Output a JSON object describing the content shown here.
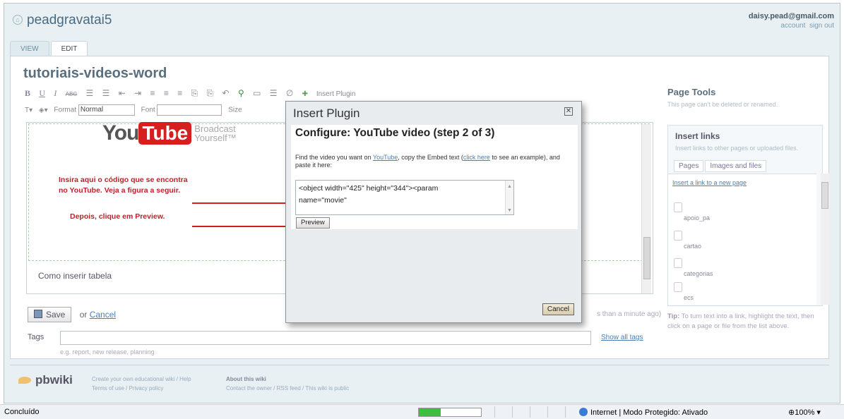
{
  "wiki": {
    "name": "peadgravatai5"
  },
  "user": {
    "email": "daisy.pead@gmail.com",
    "account": "account",
    "signout": "sign out"
  },
  "tabs": [
    {
      "label": "VIEW"
    },
    {
      "label": "EDIT",
      "active": true
    }
  ],
  "page": {
    "title": "tutoriais-videos-word"
  },
  "toolbar": {
    "row1": [
      "B",
      "U",
      "I",
      "ABC",
      "☰",
      "☰",
      "⇤",
      "⇥",
      "≡",
      "≡",
      "≡",
      "⎘",
      "⎘",
      "↶",
      "⚲",
      "▭",
      "☰",
      "∅"
    ],
    "insert_plugin": "Insert Plugin",
    "format_label": "Format",
    "format_value": "Normal",
    "font_label": "Font",
    "font_value": "",
    "size_label": "Size"
  },
  "editor": {
    "yt_you": "You",
    "yt_tube": "Tube",
    "yt_tag1": "Broadcast",
    "yt_tag2": "Yourself™",
    "note1": "Insira aqui o código que se encontra no YouTube. Veja a figura a seguir.",
    "note2": "Depois, clique em Preview.",
    "section2": "Como inserir tabela"
  },
  "actions": {
    "save": "Save",
    "or": "or",
    "cancel": "Cancel",
    "saved_msg": "s than a minute ago)"
  },
  "tags": {
    "label": "Tags",
    "hint": "e.g. report, new release, planning",
    "show_all": "Show all tags"
  },
  "sidebar": {
    "page_tools": "Page Tools",
    "page_tools_note": "This page can't be deleted or renamed.",
    "insert_links": "Insert links",
    "insert_links_note": "Insert links to other pages or uploaded files.",
    "tab_pages": "Pages",
    "tab_files": "Images and files",
    "new_page_link": "Insert a link to a new page",
    "items": [
      {
        "name": "apoio_pa"
      },
      {
        "name": "cartao"
      },
      {
        "name": "categorias"
      },
      {
        "name": "ecs"
      }
    ],
    "tip_label": "Tip:",
    "tip_text": "To turn text into a link, highlight the text, then click on a page or file from the list above."
  },
  "footer": {
    "brand": "pbwiki",
    "col1_line1": "Create your own educational wiki / Help",
    "col1_line2": "Terms of use / Privacy policy",
    "col2_title": "About this wiki",
    "col2_line2": "Contact the owner / RSS feed / This wiki is public"
  },
  "dialog": {
    "title": "Insert Plugin",
    "heading": "Configure: YouTube video (step 2 of 3)",
    "desc_before": "Find the video you want on ",
    "desc_link1": "YouTube",
    "desc_mid": ", copy the Embed text (",
    "desc_link2": "click here",
    "desc_after": " to see an example), and paste it here:",
    "embed_line1": "<object width=\"425\" height=\"344\"><param",
    "embed_line2": "name=\"movie\"",
    "preview": "Preview",
    "cancel": "Cancel"
  },
  "statusbar": {
    "left": "Concluído",
    "zone": "Internet | Modo Protegido: Ativado",
    "zoom": "100%",
    "progress": 0.35
  }
}
